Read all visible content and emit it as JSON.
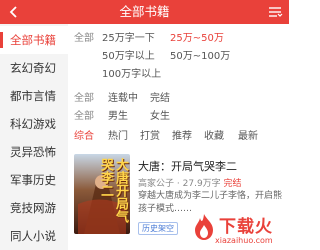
{
  "header": {
    "title": "全部书籍",
    "back_icon": "back-arrow-icon",
    "menu_icon": "list-menu-icon",
    "background_color": "#e9413a"
  },
  "sidebar": {
    "items": [
      {
        "label": "全部书籍",
        "active": true
      },
      {
        "label": "玄幻奇幻",
        "active": false
      },
      {
        "label": "都市言情",
        "active": false
      },
      {
        "label": "科幻游戏",
        "active": false
      },
      {
        "label": "灵异恐怖",
        "active": false
      },
      {
        "label": "军事历史",
        "active": false
      },
      {
        "label": "竞技网游",
        "active": false
      },
      {
        "label": "同人小说",
        "active": false
      }
    ]
  },
  "filters": {
    "word_count": {
      "label": "全部",
      "options": [
        "25万字一下",
        "25万~50万",
        "50万字以上",
        "50万~100万",
        "100万字以上"
      ],
      "selected": "25万~50万"
    },
    "status": {
      "label": "全部",
      "options": [
        "连载中",
        "完结"
      ]
    },
    "gender": {
      "label": "全部",
      "options": [
        "男生",
        "女生"
      ]
    },
    "sort": {
      "options": [
        "综合",
        "热门",
        "打赏",
        "推荐",
        "收藏",
        "最新"
      ],
      "selected": "综合"
    }
  },
  "book": {
    "cover_title": "大唐开局气哭李二",
    "title": "大唐：开局气哭李二",
    "author": "高家公子",
    "word_count": "27.9万字",
    "status": "完结",
    "description": "穿越大唐成为李二儿子李恪，开启熊孩子模式……",
    "tag": "历史架空"
  },
  "watermark": {
    "text": "下载火",
    "sub": "xiazaihuo.com",
    "color": "#e9413a"
  }
}
